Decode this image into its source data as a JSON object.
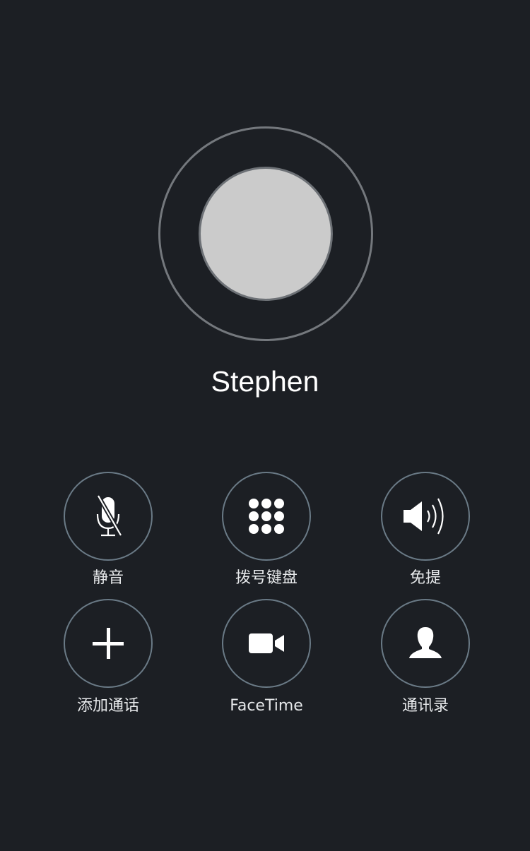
{
  "caller": {
    "name": "Stephen"
  },
  "controls": [
    {
      "label": "静音",
      "icon": "mute-microphone-icon"
    },
    {
      "label": "拨号键盘",
      "icon": "keypad-icon"
    },
    {
      "label": "免提",
      "icon": "speaker-icon"
    },
    {
      "label": "添加通话",
      "icon": "add-call-plus-icon"
    },
    {
      "label": "FaceTime",
      "icon": "video-camera-icon"
    },
    {
      "label": "通讯录",
      "icon": "contact-person-icon"
    }
  ],
  "colors": {
    "background": "#1c1f24",
    "avatar_fill": "#cbcbcb",
    "ring": "#74787d",
    "button_border": "#6a7a86",
    "text": "#ffffff"
  }
}
